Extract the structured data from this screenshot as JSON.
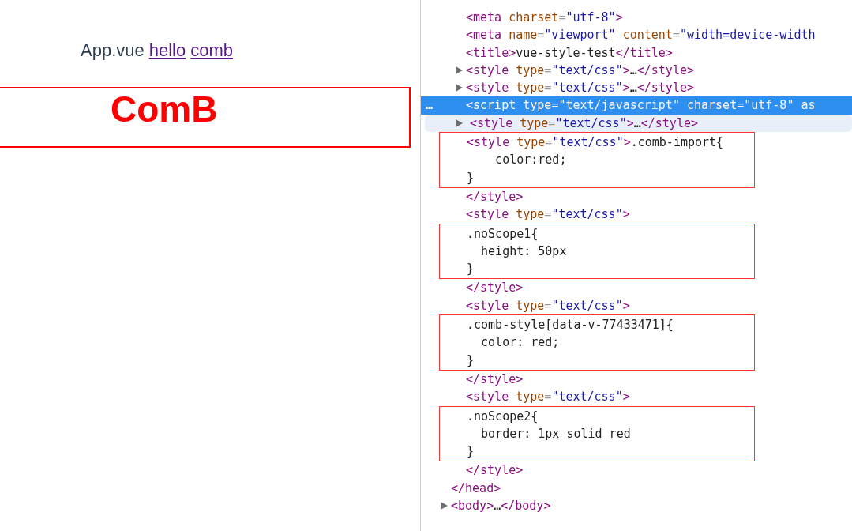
{
  "page": {
    "nav": {
      "label": "App.vue",
      "links": [
        {
          "text": "hello"
        },
        {
          "text": "comb"
        }
      ]
    },
    "component": {
      "title": "ComB"
    }
  },
  "devtools": {
    "head": {
      "children": [
        {
          "kind": "element",
          "toggle": false,
          "selected": false,
          "hovered": false,
          "segments": [
            {
              "kind": "tag",
              "s": "<meta"
            },
            {
              "kind": "attr",
              "s": " charset"
            },
            {
              "kind": "punct",
              "s": "="
            },
            {
              "kind": "value",
              "s": "\"utf-8\""
            },
            {
              "kind": "tag",
              "s": ">"
            }
          ]
        },
        {
          "kind": "element",
          "toggle": false,
          "selected": false,
          "hovered": false,
          "segments": [
            {
              "kind": "tag",
              "s": "<meta"
            },
            {
              "kind": "attr",
              "s": " name"
            },
            {
              "kind": "punct",
              "s": "="
            },
            {
              "kind": "value",
              "s": "\"viewport\""
            },
            {
              "kind": "attr",
              "s": " content"
            },
            {
              "kind": "punct",
              "s": "="
            },
            {
              "kind": "value",
              "s": "\"width=device-width"
            }
          ]
        },
        {
          "kind": "element",
          "toggle": false,
          "selected": false,
          "hovered": false,
          "segments": [
            {
              "kind": "tag",
              "s": "<title>"
            },
            {
              "kind": "text",
              "s": "vue-style-test"
            },
            {
              "kind": "tag",
              "s": "</title>"
            }
          ]
        },
        {
          "kind": "element",
          "toggle": true,
          "selected": false,
          "hovered": false,
          "segments": [
            {
              "kind": "tag",
              "s": "<style"
            },
            {
              "kind": "attr",
              "s": " type"
            },
            {
              "kind": "punct",
              "s": "="
            },
            {
              "kind": "value",
              "s": "\"text/css\""
            },
            {
              "kind": "tag",
              "s": ">"
            },
            {
              "kind": "text",
              "s": "…"
            },
            {
              "kind": "tag",
              "s": "</style>"
            }
          ]
        },
        {
          "kind": "element",
          "toggle": true,
          "selected": false,
          "hovered": false,
          "segments": [
            {
              "kind": "tag",
              "s": "<style"
            },
            {
              "kind": "attr",
              "s": " type"
            },
            {
              "kind": "punct",
              "s": "="
            },
            {
              "kind": "value",
              "s": "\"text/css\""
            },
            {
              "kind": "tag",
              "s": ">"
            },
            {
              "kind": "text",
              "s": "…"
            },
            {
              "kind": "tag",
              "s": "</style>"
            }
          ]
        },
        {
          "kind": "element",
          "toggle": false,
          "selected": true,
          "hovered": false,
          "gutter": "…",
          "segments": [
            {
              "kind": "tag",
              "s": "<script"
            },
            {
              "kind": "attr",
              "s": " type"
            },
            {
              "kind": "punct",
              "s": "="
            },
            {
              "kind": "value",
              "s": "\"text/javascript\""
            },
            {
              "kind": "attr",
              "s": " charset"
            },
            {
              "kind": "punct",
              "s": "="
            },
            {
              "kind": "value",
              "s": "\"utf-8\""
            },
            {
              "kind": "attr",
              "s": " as"
            }
          ]
        },
        {
          "kind": "element",
          "toggle": true,
          "selected": false,
          "hovered": true,
          "segments": [
            {
              "kind": "tag",
              "s": "<style"
            },
            {
              "kind": "attr",
              "s": " type"
            },
            {
              "kind": "punct",
              "s": "="
            },
            {
              "kind": "value",
              "s": "\"text/css\""
            },
            {
              "kind": "tag",
              "s": ">"
            },
            {
              "kind": "text",
              "s": "…"
            },
            {
              "kind": "tag",
              "s": "</style>"
            }
          ]
        },
        {
          "kind": "annotation",
          "lines": [
            [
              {
                "kind": "tag",
                "s": "<style"
              },
              {
                "kind": "attr",
                "s": " type"
              },
              {
                "kind": "punct",
                "s": "="
              },
              {
                "kind": "value",
                "s": "\"text/css\""
              },
              {
                "kind": "tag",
                "s": ">"
              },
              {
                "kind": "text",
                "s": ".comb-import{"
              }
            ],
            [
              {
                "kind": "text",
                "s": "    color:red;"
              }
            ],
            [
              {
                "kind": "text",
                "s": "}"
              }
            ]
          ]
        },
        {
          "kind": "element",
          "toggle": false,
          "selected": false,
          "hovered": false,
          "segments": [
            {
              "kind": "tag",
              "s": "</style>"
            }
          ]
        },
        {
          "kind": "element",
          "toggle": false,
          "selected": false,
          "hovered": false,
          "segments": [
            {
              "kind": "tag",
              "s": "<style"
            },
            {
              "kind": "attr",
              "s": " type"
            },
            {
              "kind": "punct",
              "s": "="
            },
            {
              "kind": "value",
              "s": "\"text/css\""
            },
            {
              "kind": "tag",
              "s": ">"
            }
          ]
        },
        {
          "kind": "annotation",
          "lines": [
            [
              {
                "kind": "text",
                "s": ".noScope1{"
              }
            ],
            [
              {
                "kind": "text",
                "s": "  height: 50px"
              }
            ],
            [
              {
                "kind": "text",
                "s": "}"
              }
            ]
          ]
        },
        {
          "kind": "element",
          "toggle": false,
          "selected": false,
          "hovered": false,
          "segments": [
            {
              "kind": "tag",
              "s": "</style>"
            }
          ]
        },
        {
          "kind": "element",
          "toggle": false,
          "selected": false,
          "hovered": false,
          "segments": [
            {
              "kind": "tag",
              "s": "<style"
            },
            {
              "kind": "attr",
              "s": " type"
            },
            {
              "kind": "punct",
              "s": "="
            },
            {
              "kind": "value",
              "s": "\"text/css\""
            },
            {
              "kind": "tag",
              "s": ">"
            }
          ]
        },
        {
          "kind": "annotation",
          "lines": [
            [
              {
                "kind": "text",
                "s": ".comb-style[data-v-77433471]{"
              }
            ],
            [
              {
                "kind": "text",
                "s": "  color: red;"
              }
            ],
            [
              {
                "kind": "text",
                "s": "}"
              }
            ]
          ]
        },
        {
          "kind": "element",
          "toggle": false,
          "selected": false,
          "hovered": false,
          "segments": [
            {
              "kind": "tag",
              "s": "</style>"
            }
          ]
        },
        {
          "kind": "element",
          "toggle": false,
          "selected": false,
          "hovered": false,
          "segments": [
            {
              "kind": "tag",
              "s": "<style"
            },
            {
              "kind": "attr",
              "s": " type"
            },
            {
              "kind": "punct",
              "s": "="
            },
            {
              "kind": "value",
              "s": "\"text/css\""
            },
            {
              "kind": "tag",
              "s": ">"
            }
          ]
        },
        {
          "kind": "annotation",
          "lines": [
            [
              {
                "kind": "text",
                "s": ".noScope2{"
              }
            ],
            [
              {
                "kind": "text",
                "s": "  border: 1px solid red"
              }
            ],
            [
              {
                "kind": "text",
                "s": "}"
              }
            ]
          ]
        },
        {
          "kind": "element",
          "toggle": false,
          "selected": false,
          "hovered": false,
          "segments": [
            {
              "kind": "tag",
              "s": "</style>"
            }
          ]
        }
      ],
      "closing": {
        "kind": "element",
        "toggle": false,
        "selected": false,
        "hovered": false,
        "segments": [
          {
            "kind": "tag",
            "s": "</head>"
          }
        ]
      }
    },
    "body": {
      "kind": "element",
      "toggle": true,
      "selected": false,
      "hovered": false,
      "segments": [
        {
          "kind": "tag",
          "s": "<body>"
        },
        {
          "kind": "text",
          "s": "…"
        },
        {
          "kind": "tag",
          "s": "</body>"
        }
      ]
    }
  }
}
